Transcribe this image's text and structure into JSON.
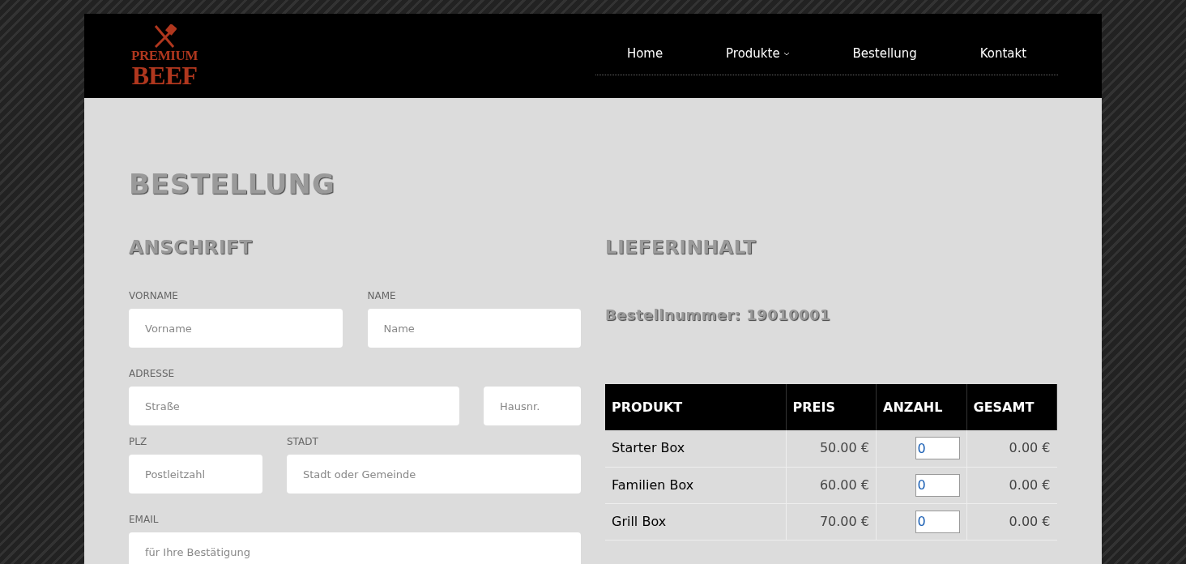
{
  "logo": {
    "line_1": "PREMIUM",
    "line_2": "BEEF"
  },
  "nav": [
    {
      "label": "Home",
      "kind": "link"
    },
    {
      "label": "Produkte",
      "kind": "dropdown"
    },
    {
      "label": "Bestellung",
      "kind": "link"
    },
    {
      "label": "Kontakt",
      "kind": "link"
    }
  ],
  "page_title": "BESTELLUNG",
  "address": {
    "heading": "ANSCHRIFT",
    "rows": [
      {
        "kind": "pair",
        "fields": [
          {
            "label": "VORNAME",
            "placeholder": "Vorname"
          },
          {
            "label": "NAME",
            "placeholder": "Name"
          }
        ]
      },
      {
        "kind": "address",
        "label": "ADRESSE",
        "fields": [
          {
            "placeholder": "Straße"
          },
          {
            "placeholder": "Hausnr."
          }
        ]
      },
      {
        "kind": "city",
        "fields": [
          {
            "label": "PLZ",
            "placeholder": "Postleitzahl"
          },
          {
            "label": "STADT",
            "placeholder": "Stadt oder Gemeinde"
          }
        ]
      },
      {
        "kind": "single",
        "fields": [
          {
            "label": "EMAIL",
            "placeholder": "für Ihre Bestätigung"
          }
        ]
      }
    ]
  },
  "delivery": {
    "heading": "LIEFERINHALT",
    "order_number": "Bestellnummer: 19010001",
    "table": {
      "columns": [
        "PRODUKT",
        "PREIS",
        "ANZAHL",
        "GESAMT"
      ],
      "rows": [
        {
          "product": "Starter Box",
          "price": "50.00 €",
          "quantity": "0",
          "total": "0.00 €"
        },
        {
          "product": "Familien Box",
          "price": "60.00 €",
          "quantity": "0",
          "total": "0.00 €"
        },
        {
          "product": "Grill Box",
          "price": "70.00 €",
          "quantity": "0",
          "total": "0.00 €"
        }
      ]
    }
  }
}
